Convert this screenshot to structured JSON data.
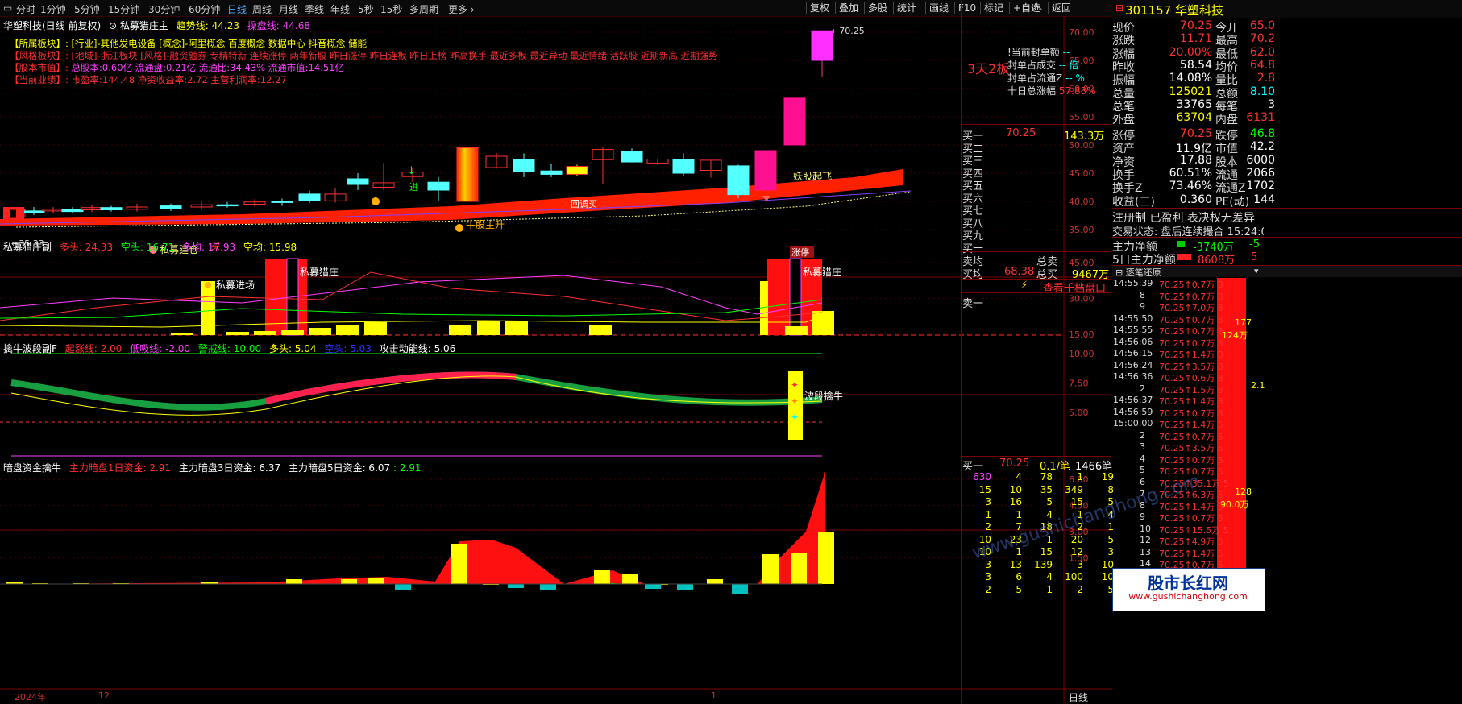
{
  "toolbar": {
    "periods": [
      "分时",
      "1分钟",
      "5分钟",
      "15分钟",
      "30分钟",
      "60分钟",
      "日线",
      "周线",
      "月线",
      "季线",
      "年线",
      "5秒",
      "15秒",
      "多周期",
      "更多"
    ],
    "active_period": "日线",
    "right_buttons": [
      "复权",
      "叠加",
      "多股",
      "统计",
      "画线",
      "F10",
      "标记",
      "+自选",
      "返回"
    ]
  },
  "main_panel": {
    "title_stock": "华塑科技(日线 前复权)",
    "indicator": "私募猎庄主",
    "trend_label": "趋势线: 44.23",
    "ctrl_label": "操盘线: 44.68",
    "info_lines": [
      {
        "tag": "【所属板块】:",
        "text": "[行业]-其他发电设备 [概念]-阿里概念 百度概念 数据中心 抖音概念 储能",
        "color": "#ffff00"
      },
      {
        "tag": "【风格板块】:",
        "text": "[地域]-浙江板块 [风格]-融资融券 专精特新 连续涨停 两年新股 昨日涨停 昨日连板 昨日上榜 昨高换手 最近多板 最近异动 最近情绪 活跃股 近期新高 近期强势",
        "color": "#ff3030"
      },
      {
        "tag": "【股本市值】:",
        "text": "总股本:0.60亿 流通盘:0.21亿 流通比:34.43% 流通市值:14.51亿",
        "color": "#ff40ff"
      },
      {
        "tag": "【当前业绩】:",
        "text": "市盈率:144.48 净资收益率:2.72 主营利润率:12.27",
        "color": "#ff3030"
      }
    ],
    "y_ticks": [
      "70.00",
      "65.00",
      "60.00",
      "55.00",
      "50.00",
      "45.00",
      "40.00",
      "35.00"
    ],
    "y_values": [
      70,
      65,
      60,
      55,
      50,
      45,
      40,
      35
    ],
    "high_label": "70.25",
    "low_label": "35.33",
    "annotations": {
      "a1": "私募建仓",
      "a2": "买",
      "a3": "进",
      "a4": "牛股主升",
      "a5": "回调买",
      "a6": "妖股起飞",
      "a7": "涨停"
    }
  },
  "panel2": {
    "title": "私募猎庄副",
    "legend": [
      {
        "t": "多头: 24.33",
        "c": "#ff3030"
      },
      {
        "t": "空头: 16.71",
        "c": "#00ff00"
      },
      {
        "t": "多均: 17.93",
        "c": "#ff40ff"
      },
      {
        "t": "空均: 15.98",
        "c": "#ffff00"
      }
    ],
    "y_ticks": [
      "45.00",
      "30.00",
      "15.00"
    ],
    "labels": {
      "l1": "私募进场",
      "l2": "私募猎庄",
      "l3": "私募猎庄"
    }
  },
  "panel3": {
    "title": "擒牛波段副F",
    "legend": [
      {
        "t": "起涨线: 2.00",
        "c": "#ff3030"
      },
      {
        "t": "低吸线: -2.00",
        "c": "#ff40ff"
      },
      {
        "t": "警戒线: 10.00",
        "c": "#00ff00"
      },
      {
        "t": "多头: 5.04",
        "c": "#ffff00"
      },
      {
        "t": "空头: 5.03",
        "c": "#3030ff"
      },
      {
        "t": "攻击动能线: 5.06",
        "c": "#ffffff"
      }
    ],
    "y_ticks": [
      "10.00",
      "7.50",
      "5.00"
    ],
    "label": "波段擒牛"
  },
  "panel4": {
    "title": "暗盘资金擒牛",
    "legend": [
      {
        "t": "主力暗盘1日资金: 2.91",
        "c": "#ff3030"
      },
      {
        "t": "主力暗盘3日资金: 6.37",
        "c": "#ffffff"
      },
      {
        "t": "主力暗盘5日资金: 6.07",
        "c": "#ffffff"
      },
      {
        "t": ": 2.91",
        "c": "#00ff00"
      }
    ],
    "y_ticks": [
      "6.00",
      "4.50",
      "3.00",
      "1.50"
    ]
  },
  "x_axis": {
    "labels": [
      "2024年",
      "12",
      "1"
    ],
    "period_tag": "日线"
  },
  "middle": {
    "ladder": "3天2板",
    "seal_lines": [
      {
        "t": "!当前封单额",
        "v": "--"
      },
      {
        "t": "封单占成交",
        "v": "-- 倍"
      },
      {
        "t": "封单占流通Z",
        "v": "-- %"
      },
      {
        "t": "十日总涨幅",
        "v": "57.83%"
      }
    ],
    "buy_labels": [
      "买一",
      "买二",
      "买三",
      "买四",
      "买五",
      "买六",
      "买七",
      "买八",
      "买九",
      "买十"
    ],
    "buy1_price": "70.25",
    "buy1_vol": "143.3万",
    "avg_sell": "卖均",
    "avg_buy": "买均",
    "avg_buy_val": "68.38",
    "total_sell": "总卖",
    "total_buy": "总买",
    "total_buy_val": "9467万",
    "view_1000": "查看千档盘口",
    "sell1": "卖一",
    "queue_head": {
      "lbl": "买一",
      "price": "70.25",
      "per": "0.1/笔",
      "count": "1466笔"
    },
    "queue": [
      [
        "630",
        "4",
        "78",
        "1",
        "19"
      ],
      [
        "15",
        "10",
        "35",
        "349",
        "8"
      ],
      [
        "3",
        "16",
        "5",
        "15",
        "5"
      ],
      [
        "1",
        "1",
        "4",
        "1",
        "4"
      ],
      [
        "2",
        "7",
        "18",
        "2",
        "1"
      ],
      [
        "10",
        "23",
        "1",
        "20",
        "5"
      ],
      [
        "10",
        "1",
        "15",
        "12",
        "3"
      ],
      [
        "3",
        "13",
        "139",
        "3",
        "10"
      ],
      [
        "3",
        "6",
        "4",
        "100",
        "10"
      ],
      [
        "2",
        "5",
        "1",
        "2",
        "5"
      ]
    ]
  },
  "quote": {
    "code": "301157",
    "name": "华塑科技",
    "rows": [
      [
        "现价",
        "70.25",
        "今开",
        "65.0"
      ],
      [
        "涨跌",
        "11.71",
        "最高",
        "70.2"
      ],
      [
        "涨幅",
        "20.00%",
        "最低",
        "62.0"
      ],
      [
        "昨收",
        "58.54",
        "均价",
        "64.8"
      ],
      [
        "振幅",
        "14.08%",
        "量比",
        "2.8"
      ],
      [
        "总量",
        "125021",
        "总额",
        "8.10"
      ],
      [
        "总笔",
        "33765",
        "每笔",
        "3"
      ],
      [
        "外盘",
        "63704",
        "内盘",
        "6131"
      ]
    ],
    "rows2": [
      [
        "涨停",
        "70.25",
        "跌停",
        "46.8"
      ],
      [
        "资产",
        "11.9亿",
        "市值",
        "42.2"
      ],
      [
        "净资",
        "17.88",
        "股本",
        "6000"
      ],
      [
        "换手",
        "60.51%",
        "流通",
        "2066"
      ],
      [
        "换手Z",
        "73.46%",
        "流通Z",
        "1702"
      ],
      [
        "收益(三)",
        "0.360",
        "PE(动)",
        "144"
      ]
    ],
    "reg": "注册制 已盈利 表决权无差异",
    "trade_state": "交易状态: 盘后连续撮合 15:24:0",
    "main_net": "主力净额",
    "main_net_val": "-3740万",
    "main_net_val2": "-5",
    "main5": "5日主力净额",
    "main5_val": "8608万",
    "main5_val2": "5",
    "tick_title": "逐笔还原",
    "ticks": [
      [
        "14:55:39",
        "70.25",
        "0.7万",
        "8"
      ],
      [
        "8",
        "70.25",
        "0.7万",
        "8"
      ],
      [
        "9",
        "70.25",
        "7.0万",
        "8"
      ],
      [
        "14:55:50",
        "70.25",
        "0.7万",
        "8"
      ],
      [
        "14:55:55",
        "70.25",
        "0.7万",
        "8"
      ],
      [
        "14:56:06",
        "70.25",
        "0.7万",
        "8"
      ],
      [
        "14:56:15",
        "70.25",
        "1.4万",
        "8"
      ],
      [
        "14:56:24",
        "70.25",
        "3.5万",
        "8"
      ],
      [
        "14:56:36",
        "70.25",
        "0.6万",
        "8"
      ],
      [
        "2",
        "70.25",
        "1.5万",
        "8"
      ],
      [
        "14:56:37",
        "70.25",
        "1.4万",
        "8"
      ],
      [
        "14:56:59",
        "70.25",
        "0.7万",
        "8"
      ],
      [
        "15:00:00",
        "70.25",
        "1.4万",
        "5"
      ],
      [
        "2",
        "70.25",
        "0.7万",
        "5"
      ],
      [
        "3",
        "70.25",
        "3.5万",
        "5"
      ],
      [
        "4",
        "70.25",
        "0.7万",
        "5"
      ],
      [
        "5",
        "70.25",
        "0.7万",
        "5"
      ],
      [
        "6",
        "70.25",
        "35.1万",
        "5"
      ],
      [
        "7",
        "70.25",
        "6.3万",
        "5"
      ],
      [
        "8",
        "70.25",
        "1.4万",
        "5"
      ],
      [
        "9",
        "70.25",
        "0.7万",
        "5"
      ],
      [
        "10",
        "70.25",
        "15.5万",
        "5"
      ],
      [
        "12",
        "70.25",
        "4.9万",
        "5"
      ],
      [
        "13",
        "70.25",
        "1.4万",
        "5"
      ],
      [
        "14",
        "70.25",
        "0.7万",
        "5"
      ]
    ],
    "bar1": "177",
    "bar1b": "124万",
    "bar2": "128",
    "bar2b": "90.0万",
    "side_val": "2.1",
    "watermark": "www.gushichanghong.com",
    "logo_cn": "股市长红网",
    "logo_url": "www.gushichanghong.com"
  },
  "colors": {
    "up": "#ff3030",
    "down": "#54ffff",
    "grid": "#7a0000",
    "bg": "#000000"
  }
}
